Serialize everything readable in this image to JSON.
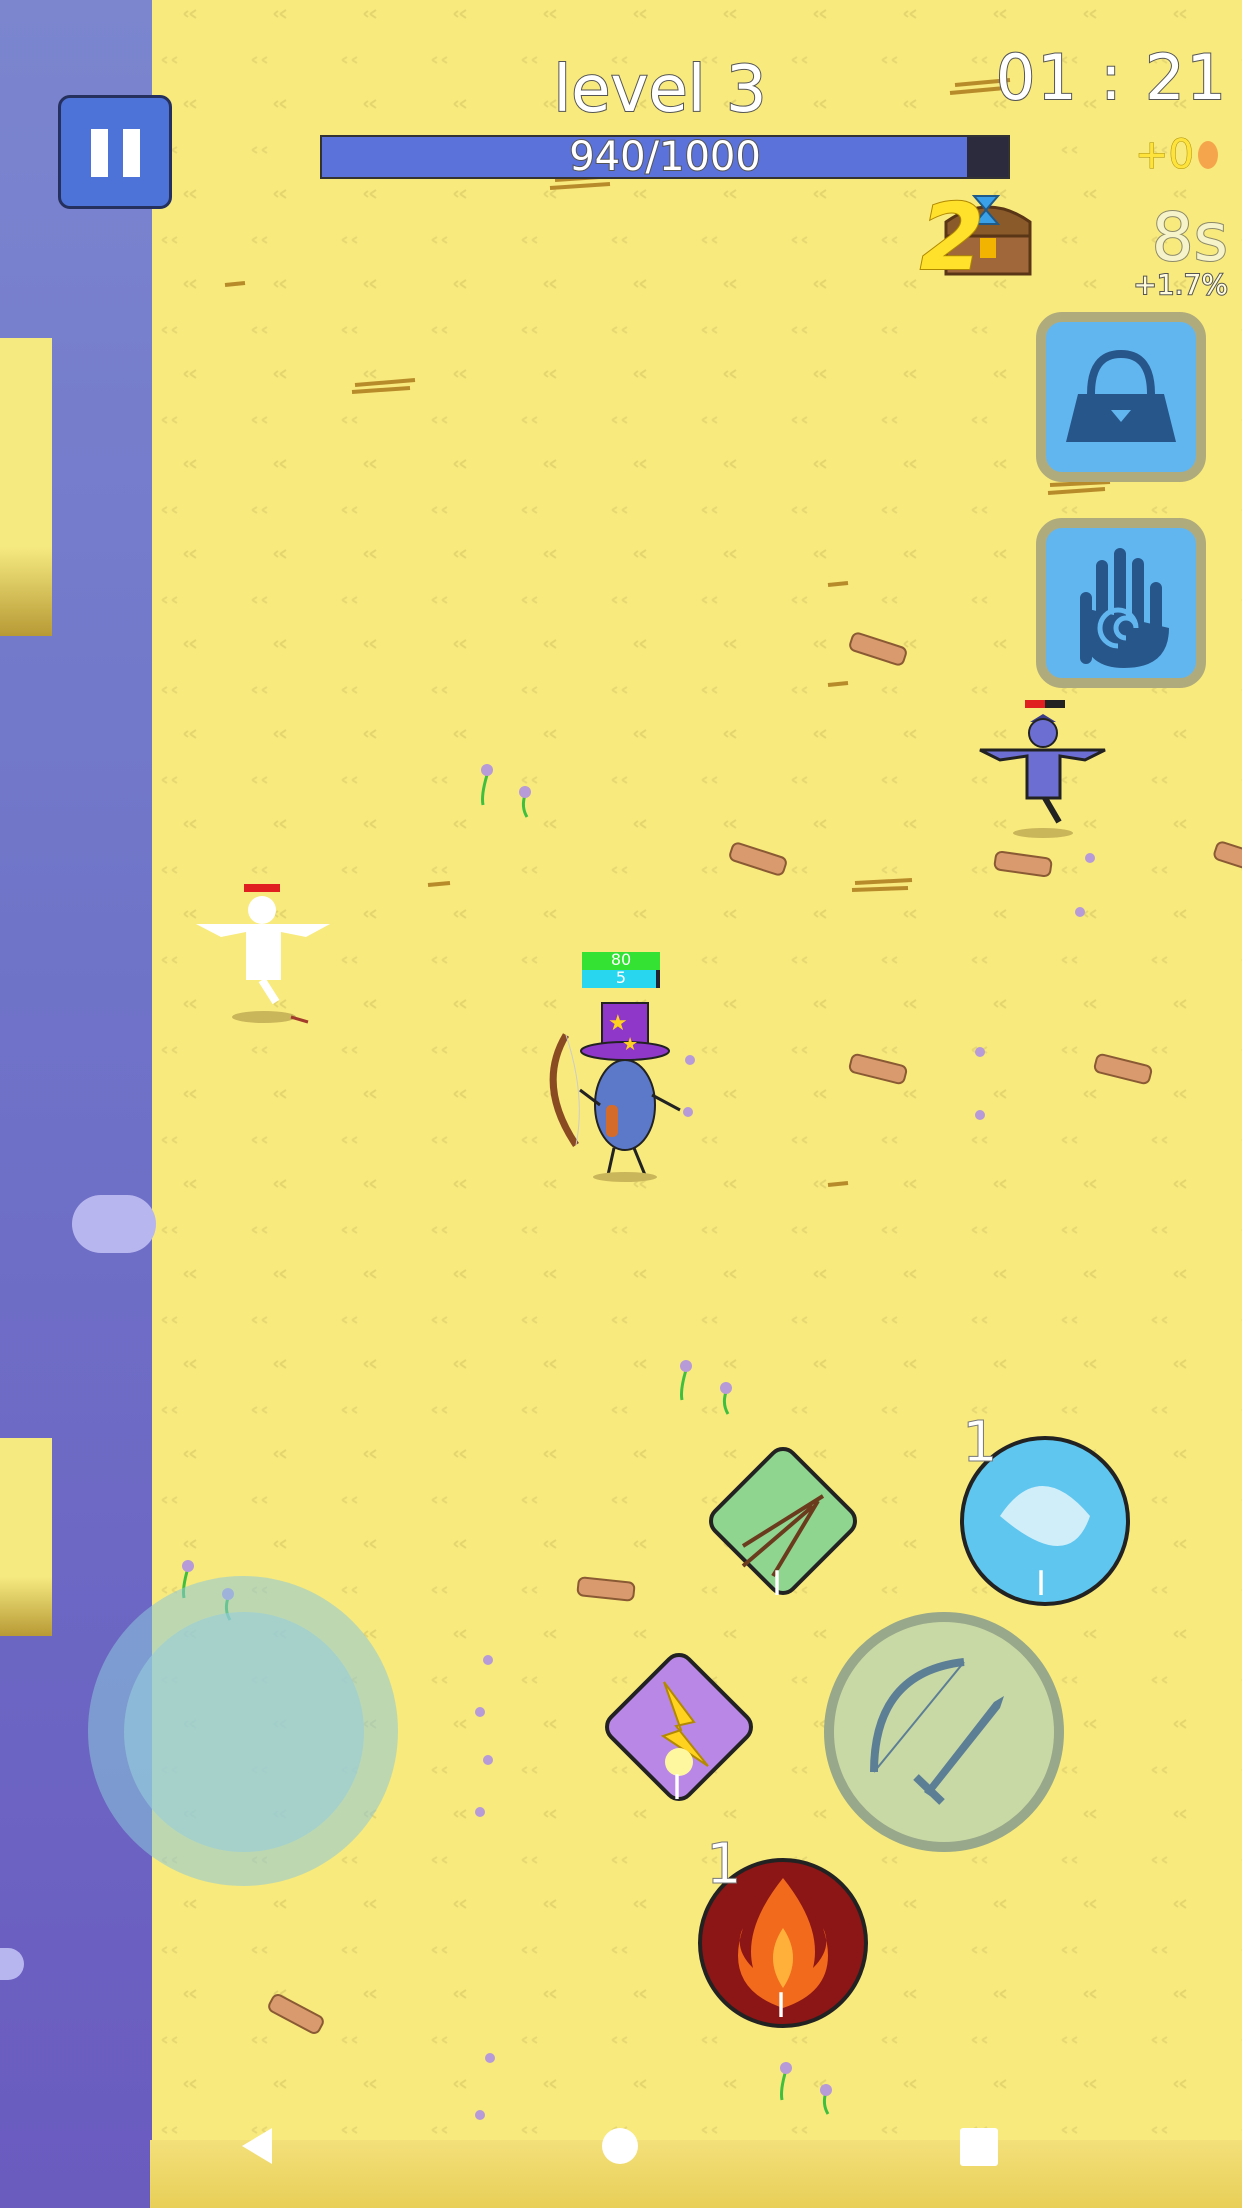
{
  "hud": {
    "level_label": "level 3",
    "xp_text": "940/1000",
    "xp_progress": 0.94,
    "timer": "01 : 21",
    "coins": "+0",
    "chest_count": "2",
    "chest_timer": "8s",
    "chest_bonus": "+1.7%"
  },
  "player": {
    "hp_value": "80",
    "shield_value": "5"
  },
  "skills": {
    "ice_charge": "1",
    "fire_charge": "1",
    "arrow_rank": "I",
    "ice_rank": "I",
    "lightning_rank": "I",
    "fire_rank": "I"
  },
  "colors": {
    "field": "#f8ea7c",
    "void": "#6f73c8",
    "xp_fill": "#5a72da",
    "side_button": "#62b6f0",
    "hp_bar": "#33e233",
    "shield_bar": "#29d6f0"
  },
  "icons": {
    "pause": "pause-icon",
    "inventory": "bag-icon",
    "abilities": "spiral-hand-icon",
    "chest": "treasure-chest-icon",
    "attack": "bow-sword-icon"
  }
}
